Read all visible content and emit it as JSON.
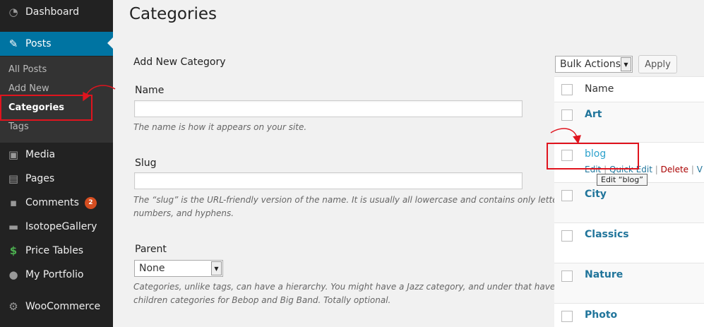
{
  "sidebar": {
    "items": [
      {
        "label": "Dashboard",
        "icon": "dashboard-icon",
        "glyph": "◔"
      },
      {
        "label": "Posts",
        "icon": "pin-icon",
        "glyph": "✎"
      },
      {
        "label": "Media",
        "icon": "media-icon",
        "glyph": "▣"
      },
      {
        "label": "Pages",
        "icon": "pages-icon",
        "glyph": "▤"
      },
      {
        "label": "Comments",
        "icon": "comment-icon",
        "glyph": "▪",
        "badge": "2"
      },
      {
        "label": "IsotopeGallery",
        "icon": "gallery-icon",
        "glyph": "▬"
      },
      {
        "label": "Price Tables",
        "icon": "dollar-icon",
        "glyph": "$"
      },
      {
        "label": "My Portfolio",
        "icon": "portfolio-icon",
        "glyph": "●"
      },
      {
        "label": "WooCommerce",
        "icon": "woocommerce-icon",
        "glyph": "⚙"
      }
    ],
    "submenu": [
      "All Posts",
      "Add New",
      "Categories",
      "Tags"
    ]
  },
  "page": {
    "title": "Categories"
  },
  "form": {
    "title": "Add New Category",
    "name_label": "Name",
    "name_desc": "The name is how it appears on your site.",
    "slug_label": "Slug",
    "slug_desc_1": "The “slug” is the URL-friendly version of the name. It is usually all lowercase and contains only letters,",
    "slug_desc_2": "numbers, and hyphens.",
    "parent_label": "Parent",
    "parent_value": "None",
    "parent_desc_1": "Categories, unlike tags, can have a hierarchy. You might have a Jazz category, and under that have",
    "parent_desc_2": "children categories for Bebop and Big Band. Totally optional."
  },
  "list": {
    "bulk_actions": "Bulk Actions",
    "apply": "Apply",
    "column_name": "Name",
    "categories": [
      "Art",
      "blog",
      "City",
      "Classics",
      "Nature",
      "Photo"
    ],
    "row_actions": {
      "edit": "Edit",
      "sep": "|",
      "quick_edit": "Quick Edit",
      "delete": "Delete",
      "view": "V"
    },
    "tooltip": "Edit “blog”"
  },
  "colors": {
    "sidebar_bg": "#222222",
    "active_bg": "#0074a2",
    "link": "#21759b",
    "highlight": "#e0141e",
    "delete": "#aa0000"
  }
}
